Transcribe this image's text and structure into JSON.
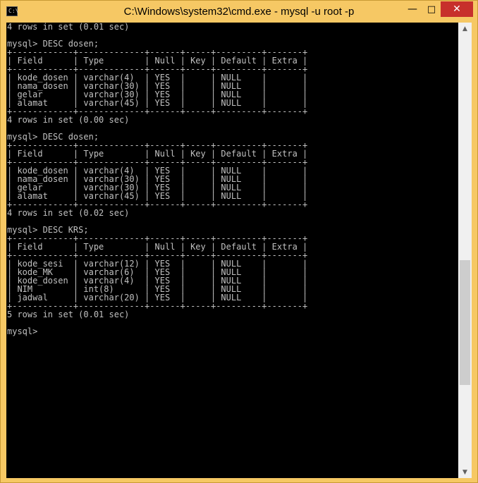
{
  "window": {
    "title": "C:\\Windows\\system32\\cmd.exe - mysql  -u root -p",
    "icon_label": "C:\\",
    "minimize_glyph": "—",
    "maximize_glyph": "□",
    "close_glyph": "✕"
  },
  "console": {
    "lines": [
      "4 rows in set (0.01 sec)",
      "",
      "mysql> DESC dosen;",
      "+------------+-------------+------+-----+---------+-------+",
      "| Field      | Type        | Null | Key | Default | Extra |",
      "+------------+-------------+------+-----+---------+-------+",
      "| kode_dosen | varchar(4)  | YES  |     | NULL    |       |",
      "| nama_dosen | varchar(30) | YES  |     | NULL    |       |",
      "| gelar      | varchar(30) | YES  |     | NULL    |       |",
      "| alamat     | varchar(45) | YES  |     | NULL    |       |",
      "+------------+-------------+------+-----+---------+-------+",
      "4 rows in set (0.00 sec)",
      "",
      "mysql> DESC dosen;",
      "+------------+-------------+------+-----+---------+-------+",
      "| Field      | Type        | Null | Key | Default | Extra |",
      "+------------+-------------+------+-----+---------+-------+",
      "| kode_dosen | varchar(4)  | YES  |     | NULL    |       |",
      "| nama_dosen | varchar(30) | YES  |     | NULL    |       |",
      "| gelar      | varchar(30) | YES  |     | NULL    |       |",
      "| alamat     | varchar(45) | YES  |     | NULL    |       |",
      "+------------+-------------+------+-----+---------+-------+",
      "4 rows in set (0.02 sec)",
      "",
      "mysql> DESC KRS;",
      "+------------+-------------+------+-----+---------+-------+",
      "| Field      | Type        | Null | Key | Default | Extra |",
      "+------------+-------------+------+-----+---------+-------+",
      "| kode_sesi  | varchar(12) | YES  |     | NULL    |       |",
      "| kode_MK    | varchar(6)  | YES  |     | NULL    |       |",
      "| kode_dosen | varchar(4)  | YES  |     | NULL    |       |",
      "| NIM        | int(8)      | YES  |     | NULL    |       |",
      "| jadwal     | varchar(20) | YES  |     | NULL    |       |",
      "+------------+-------------+------+-----+---------+-------+",
      "5 rows in set (0.01 sec)",
      "",
      "mysql>"
    ]
  },
  "scrollbar": {
    "up_glyph": "▲",
    "down_glyph": "▼"
  },
  "icons": {
    "app": "cmd-icon",
    "minimize": "minimize-icon",
    "maximize": "maximize-icon",
    "close": "close-icon"
  }
}
